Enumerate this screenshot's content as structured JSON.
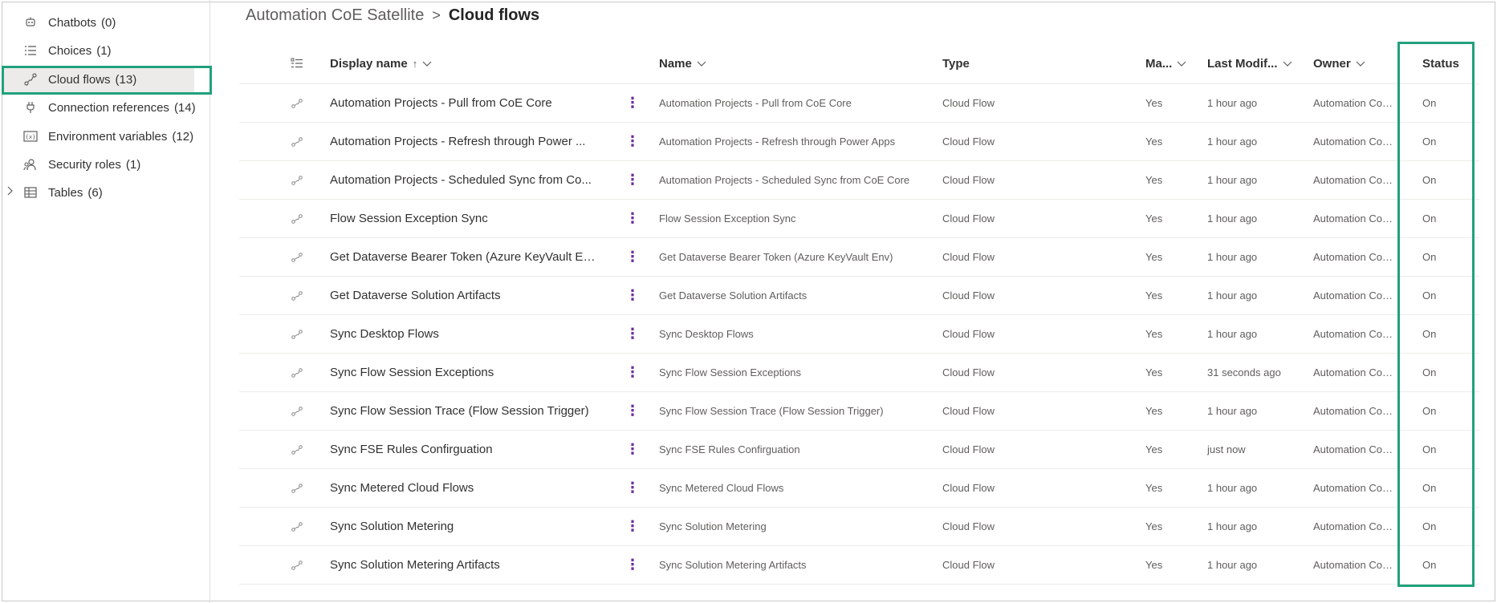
{
  "sidebar": {
    "items": [
      {
        "label": "Chatbots",
        "count": "(0)",
        "icon": "chatbot-icon"
      },
      {
        "label": "Choices",
        "count": "(1)",
        "icon": "list-icon"
      },
      {
        "label": "Cloud flows",
        "count": "(13)",
        "icon": "flow-icon",
        "selected": true
      },
      {
        "label": "Connection references",
        "count": "(14)",
        "icon": "plug-icon"
      },
      {
        "label": "Environment variables",
        "count": "(12)",
        "icon": "variable-icon"
      },
      {
        "label": "Security roles",
        "count": "(1)",
        "icon": "people-icon"
      },
      {
        "label": "Tables",
        "count": "(6)",
        "icon": "table-icon",
        "expandable": true
      }
    ]
  },
  "breadcrumb": {
    "parent": "Automation CoE Satellite",
    "separator": ">",
    "current": "Cloud flows"
  },
  "grid": {
    "headers": {
      "display_name": "Display name",
      "name": "Name",
      "type": "Type",
      "managed": "Ma...",
      "last_modified": "Last Modif...",
      "owner": "Owner",
      "status": "Status"
    },
    "rows": [
      {
        "display": "Automation Projects - Pull from CoE Core",
        "name": "Automation Projects - Pull from CoE Core",
        "type": "Cloud Flow",
        "managed": "Yes",
        "modified": "1 hour ago",
        "owner": "Automation CoE ...",
        "status": "On"
      },
      {
        "display": "Automation Projects - Refresh through Power ...",
        "name": "Automation Projects - Refresh through Power Apps",
        "type": "Cloud Flow",
        "managed": "Yes",
        "modified": "1 hour ago",
        "owner": "Automation CoE ...",
        "status": "On"
      },
      {
        "display": "Automation Projects - Scheduled Sync from Co...",
        "name": "Automation Projects - Scheduled Sync from CoE Core",
        "type": "Cloud Flow",
        "managed": "Yes",
        "modified": "1 hour ago",
        "owner": "Automation CoE ...",
        "status": "On"
      },
      {
        "display": "Flow Session Exception Sync",
        "name": "Flow Session Exception Sync",
        "type": "Cloud Flow",
        "managed": "Yes",
        "modified": "1 hour ago",
        "owner": "Automation CoE ...",
        "status": "On"
      },
      {
        "display": "Get Dataverse Bearer Token (Azure KeyVault En...",
        "name": "Get Dataverse Bearer Token (Azure KeyVault Env)",
        "type": "Cloud Flow",
        "managed": "Yes",
        "modified": "1 hour ago",
        "owner": "Automation CoE ...",
        "status": "On"
      },
      {
        "display": "Get Dataverse Solution Artifacts",
        "name": "Get Dataverse Solution Artifacts",
        "type": "Cloud Flow",
        "managed": "Yes",
        "modified": "1 hour ago",
        "owner": "Automation CoE ...",
        "status": "On"
      },
      {
        "display": "Sync Desktop Flows",
        "name": "Sync Desktop Flows",
        "type": "Cloud Flow",
        "managed": "Yes",
        "modified": "1 hour ago",
        "owner": "Automation CoE ...",
        "status": "On"
      },
      {
        "display": "Sync Flow Session Exceptions",
        "name": "Sync Flow Session Exceptions",
        "type": "Cloud Flow",
        "managed": "Yes",
        "modified": "31 seconds ago",
        "owner": "Automation CoE ...",
        "status": "On"
      },
      {
        "display": "Sync Flow Session Trace (Flow Session Trigger)",
        "name": "Sync Flow Session Trace (Flow Session Trigger)",
        "type": "Cloud Flow",
        "managed": "Yes",
        "modified": "1 hour ago",
        "owner": "Automation CoE ...",
        "status": "On"
      },
      {
        "display": "Sync FSE Rules Confirguation",
        "name": "Sync FSE Rules Confirguation",
        "type": "Cloud Flow",
        "managed": "Yes",
        "modified": "just now",
        "owner": "Automation CoE ...",
        "status": "On"
      },
      {
        "display": "Sync Metered Cloud Flows",
        "name": "Sync Metered Cloud Flows",
        "type": "Cloud Flow",
        "managed": "Yes",
        "modified": "1 hour ago",
        "owner": "Automation CoE ...",
        "status": "On"
      },
      {
        "display": "Sync Solution Metering",
        "name": "Sync Solution Metering",
        "type": "Cloud Flow",
        "managed": "Yes",
        "modified": "1 hour ago",
        "owner": "Automation CoE ...",
        "status": "On"
      },
      {
        "display": "Sync Solution Metering Artifacts",
        "name": "Sync Solution Metering Artifacts",
        "type": "Cloud Flow",
        "managed": "Yes",
        "modified": "1 hour ago",
        "owner": "Automation CoE ...",
        "status": "On"
      }
    ]
  },
  "colors": {
    "highlight": "#21a17c",
    "more_dots": "#6b2fa0"
  }
}
